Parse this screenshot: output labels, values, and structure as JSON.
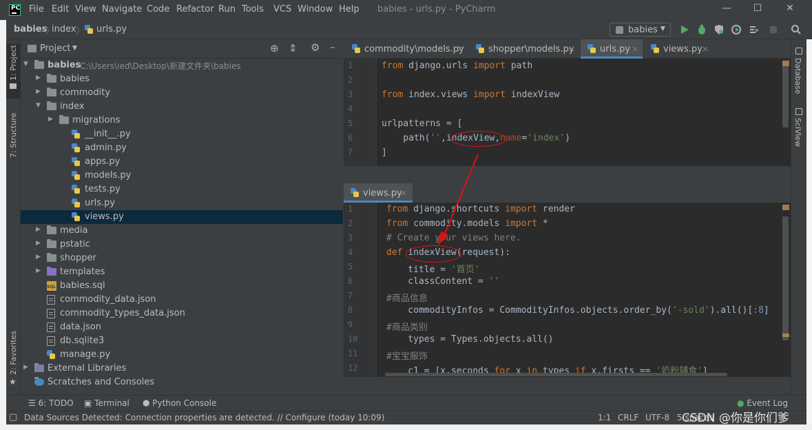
{
  "window": {
    "title": "babies - urls.py - PyCharm",
    "menu": [
      "File",
      "Edit",
      "View",
      "Navigate",
      "Code",
      "Refactor",
      "Run",
      "Tools",
      "VCS",
      "Window",
      "Help"
    ],
    "controls": [
      "—",
      "☐",
      "✕"
    ]
  },
  "breadcrumb": [
    "babies",
    "index",
    "urls.py"
  ],
  "run_config": "babies",
  "left_stripe": [
    "1: Project",
    "7: Structure",
    "2: Favorites"
  ],
  "right_stripe": [
    "Database",
    "SciView"
  ],
  "project": {
    "header": "Project",
    "root_name": "babies",
    "root_path": "C:\\Users\\ied\\Desktop\\新建文件夹\\babies",
    "tree": [
      {
        "label": "babies",
        "kind": "folder",
        "depth": 1,
        "arrow": "▶"
      },
      {
        "label": "commodity",
        "kind": "folder",
        "depth": 1,
        "arrow": "▶"
      },
      {
        "label": "index",
        "kind": "folder",
        "depth": 1,
        "arrow": "▼"
      },
      {
        "label": "migrations",
        "kind": "folder",
        "depth": 2,
        "arrow": "▶"
      },
      {
        "label": "__init__.py",
        "kind": "py",
        "depth": 3
      },
      {
        "label": "admin.py",
        "kind": "py",
        "depth": 3
      },
      {
        "label": "apps.py",
        "kind": "py",
        "depth": 3
      },
      {
        "label": "models.py",
        "kind": "py",
        "depth": 3
      },
      {
        "label": "tests.py",
        "kind": "py",
        "depth": 3
      },
      {
        "label": "urls.py",
        "kind": "py",
        "depth": 3
      },
      {
        "label": "views.py",
        "kind": "py",
        "depth": 3,
        "selected": true
      },
      {
        "label": "media",
        "kind": "folder",
        "depth": 1,
        "arrow": "▶"
      },
      {
        "label": "pstatic",
        "kind": "folder",
        "depth": 1,
        "arrow": "▶"
      },
      {
        "label": "shopper",
        "kind": "folder",
        "depth": 1,
        "arrow": "▶"
      },
      {
        "label": "templates",
        "kind": "purple",
        "depth": 1,
        "arrow": "▶"
      },
      {
        "label": "babies.sql",
        "kind": "sql",
        "depth": 1
      },
      {
        "label": "commodity_data.json",
        "kind": "json",
        "depth": 1
      },
      {
        "label": "commodity_types_data.json",
        "kind": "json",
        "depth": 1
      },
      {
        "label": "data.json",
        "kind": "json",
        "depth": 1
      },
      {
        "label": "db.sqlite3",
        "kind": "json",
        "depth": 1
      },
      {
        "label": "manage.py",
        "kind": "py",
        "depth": 1
      },
      {
        "label": "External Libraries",
        "kind": "lib",
        "depth": 0,
        "arrow": "▶"
      },
      {
        "label": "Scratches and Consoles",
        "kind": "scratch",
        "depth": 0
      }
    ]
  },
  "editor_tabs": [
    {
      "label": "commodity\\models.py",
      "active": false
    },
    {
      "label": "shopper\\models.py",
      "active": false
    },
    {
      "label": "urls.py",
      "active": true
    },
    {
      "label": "views.py",
      "active": false
    }
  ],
  "tab_close": "×",
  "split_tab": "views.py",
  "editor_top_lines": [
    "1",
    "2",
    "3",
    "4",
    "5",
    "6",
    "7"
  ],
  "editor_bottom_lines": [
    "1",
    "2",
    "3",
    "4",
    "5",
    "6",
    "7",
    "8",
    "9",
    "10",
    "11",
    "12"
  ],
  "code_top": [
    [
      [
        "kw",
        "from"
      ],
      [
        "t",
        " django.urls "
      ],
      [
        "kw",
        "import"
      ],
      [
        "t",
        " path"
      ]
    ],
    [],
    [
      [
        "kw",
        "from"
      ],
      [
        "t",
        " index.views "
      ],
      [
        "kw",
        "import"
      ],
      [
        "t",
        " indexView"
      ]
    ],
    [],
    [
      [
        "t",
        "urlpatterns = ["
      ]
    ],
    [
      [
        "t",
        "    path("
      ],
      [
        "str",
        "''"
      ],
      [
        "t",
        ","
      ],
      [
        "t",
        "indexView"
      ],
      [
        "t",
        ","
      ],
      [
        "named",
        "name"
      ],
      [
        "t",
        "="
      ],
      [
        "str",
        "'index'"
      ],
      [
        "t",
        ")"
      ]
    ],
    [
      [
        "t",
        "]"
      ]
    ]
  ],
  "code_bottom": [
    [
      [
        "kw",
        "from"
      ],
      [
        "t",
        " django.shortcuts "
      ],
      [
        "kw",
        "import"
      ],
      [
        "t",
        " render"
      ]
    ],
    [
      [
        "kw",
        "from"
      ],
      [
        "t",
        " commodity.models "
      ],
      [
        "kw",
        "import"
      ],
      [
        "t",
        " *"
      ]
    ],
    [
      [
        "cmt",
        "# Create your views here."
      ]
    ],
    [
      [
        "kw",
        "def "
      ],
      [
        "t",
        "indexView(request):"
      ]
    ],
    [
      [
        "t",
        "    title = "
      ],
      [
        "str",
        "'首页'"
      ]
    ],
    [
      [
        "t",
        "    classContent = "
      ],
      [
        "str",
        "''"
      ]
    ],
    [
      [
        "cmt",
        "#商品信息"
      ]
    ],
    [
      [
        "t",
        "    commodityInfos = CommodityInfos.objects.order_by("
      ],
      [
        "str",
        "'-sold'"
      ],
      [
        "t",
        ").all()["
      ],
      [
        "num",
        ":8"
      ],
      [
        "t",
        "]"
      ]
    ],
    [
      [
        "cmt",
        "#商品类别"
      ]
    ],
    [
      [
        "t",
        "    types = Types.objects.all()"
      ]
    ],
    [
      [
        "cmt",
        "#宝宝服饰"
      ]
    ],
    [
      [
        "t",
        "    c1 = [x.seconds "
      ],
      [
        "kw",
        "for"
      ],
      [
        "t",
        " x "
      ],
      [
        "kw",
        "in"
      ],
      [
        "t",
        " types "
      ],
      [
        "kw",
        "if"
      ],
      [
        "t",
        " x.firsts == "
      ],
      [
        "str",
        "'奶粉辅食'"
      ],
      [
        "t",
        "]"
      ]
    ]
  ],
  "toolwindows": {
    "todo": "6: TODO",
    "terminal": "Terminal",
    "console": "Python Console",
    "events": "Event Log"
  },
  "status": {
    "message": "Data Sources Detected: Connection properties are detected. // Configure (today 10:09)",
    "position": "1:1",
    "line_sep": "CRLF",
    "encoding": "UTF-8",
    "indent": "5 spaces"
  },
  "watermark": "CSDN @你是你们爹",
  "colors": {
    "accent": "#4a88c7",
    "annotation": "#e11111",
    "keyword": "#cc7832",
    "string": "#6a8759",
    "comment": "#808080"
  }
}
